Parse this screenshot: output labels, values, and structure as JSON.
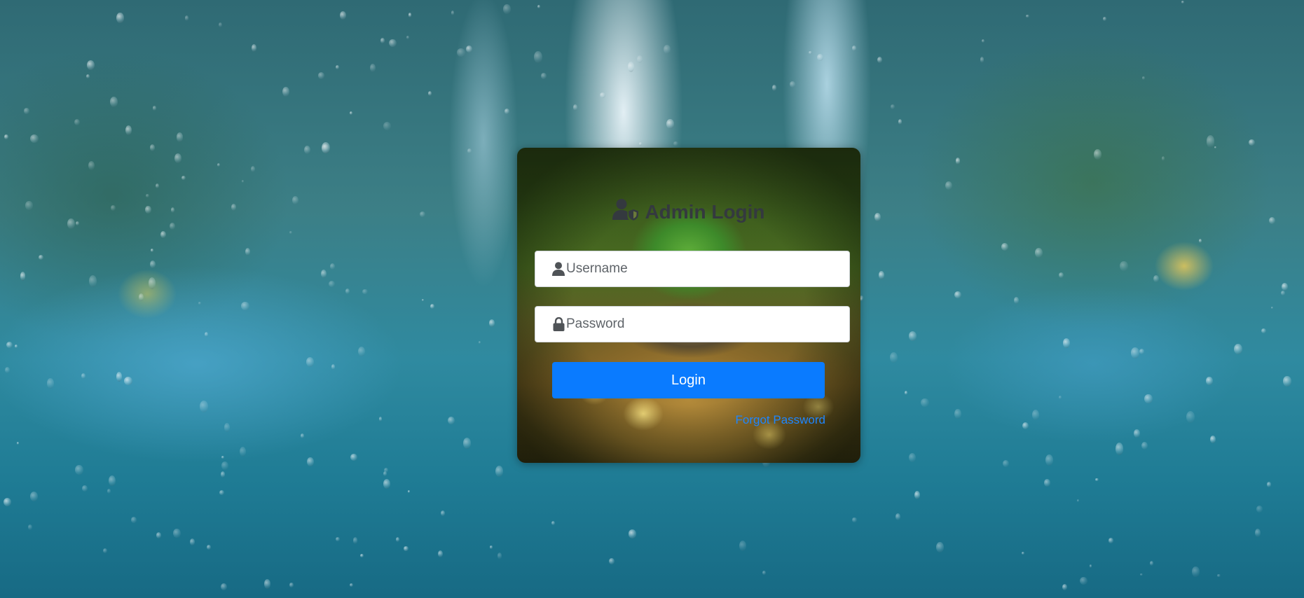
{
  "page": {
    "title": "Admin Login"
  },
  "login_form": {
    "title": "Admin Login",
    "title_icon": "user-shield-icon",
    "username": {
      "placeholder": "Username",
      "value": "",
      "icon": "user-icon"
    },
    "password": {
      "placeholder": "Password",
      "value": "",
      "icon": "lock-icon"
    },
    "login_label": "Login",
    "forgot_label": "Forgot Password"
  },
  "colors": {
    "accent": "#0a7bff",
    "link": "#1e86ff",
    "title_text": "#34393f"
  }
}
